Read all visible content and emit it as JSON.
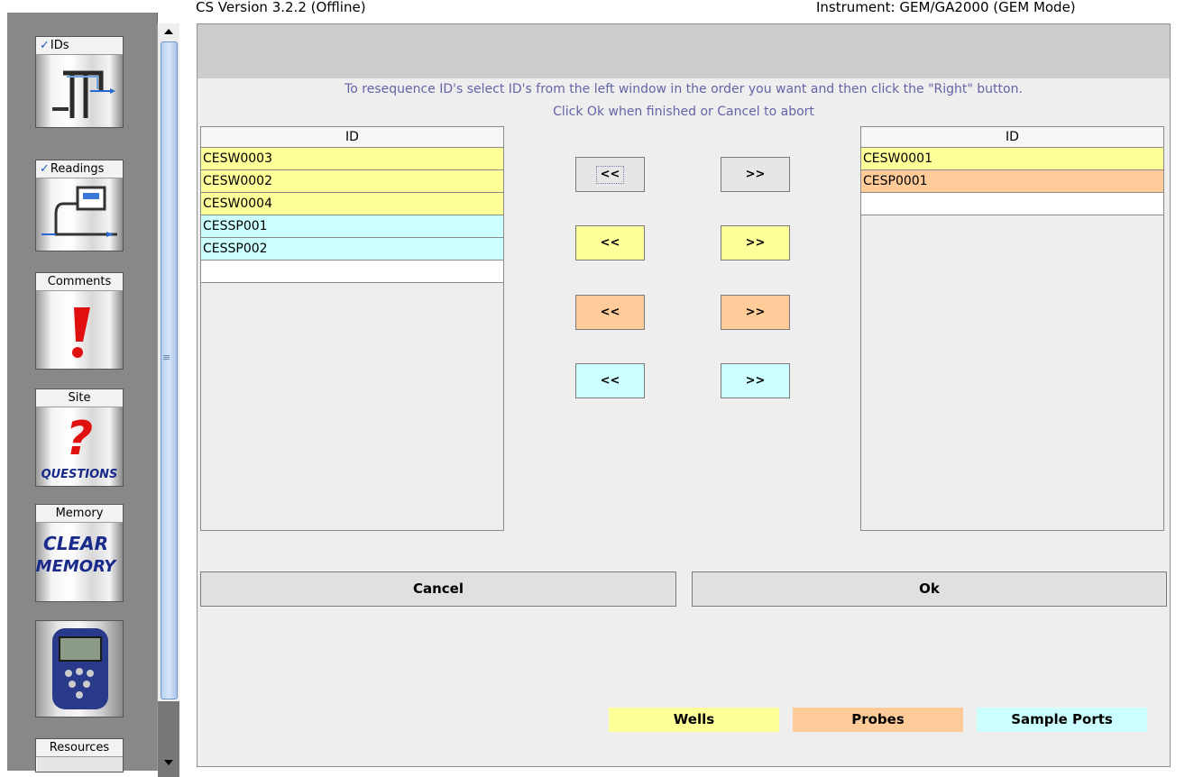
{
  "header": {
    "version_text": "CS Version 3.2.2 (Offline)",
    "instrument_text": "Instrument: GEM/GA2000 (GEM Mode)"
  },
  "sidebar": {
    "tools": [
      {
        "label": "IDs",
        "checked": true
      },
      {
        "label": "Readings",
        "checked": true
      },
      {
        "label": "Comments",
        "checked": false
      },
      {
        "label": "Site",
        "checked": false,
        "art_text": "QUESTIONS"
      },
      {
        "label": "Memory",
        "checked": false,
        "art_text_1": "CLEAR",
        "art_text_2": "MEMORY"
      },
      {
        "label": "",
        "checked": false
      },
      {
        "label": "Resources",
        "checked": false
      }
    ],
    "checkmark": "✓"
  },
  "dialog": {
    "instruction_line1": "To resequence ID's select ID's from the left window in the order you want  and then click the \"Right\" button.",
    "instruction_line2": "Click Ok when finished or Cancel to abort",
    "left_list": {
      "header": "ID",
      "rows": [
        {
          "text": "CESW0003",
          "type": "well"
        },
        {
          "text": "CESW0002",
          "type": "well"
        },
        {
          "text": "CESW0004",
          "type": "well"
        },
        {
          "text": "CESSP001",
          "type": "port"
        },
        {
          "text": "CESSP002",
          "type": "port"
        },
        {
          "text": "",
          "type": "blank"
        }
      ]
    },
    "right_list": {
      "header": "ID",
      "rows": [
        {
          "text": "CESW0001",
          "type": "well"
        },
        {
          "text": "CESP0001",
          "type": "probe"
        },
        {
          "text": "",
          "type": "blank"
        }
      ]
    },
    "move_buttons": {
      "left_label": "<<",
      "right_label": ">>"
    },
    "cancel_label": "Cancel",
    "ok_label": "Ok",
    "legend": {
      "wells": "Wells",
      "probes": "Probes",
      "ports": "Sample Ports"
    }
  },
  "colors": {
    "well": "#ffff99",
    "probe": "#ffcc99",
    "port": "#ccffff",
    "instruction_text": "#6464a6"
  }
}
